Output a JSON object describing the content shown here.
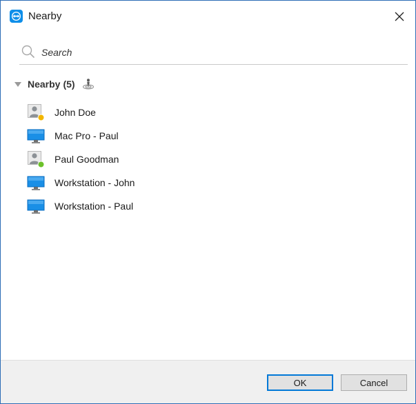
{
  "window": {
    "title": "Nearby",
    "close_symbol": "✕"
  },
  "search": {
    "placeholder": "Search",
    "value": ""
  },
  "group": {
    "title": "Nearby",
    "count": "(5)"
  },
  "items": [
    {
      "label": "John Doe",
      "type": "contact",
      "status": "away",
      "status_color": "#f2b600"
    },
    {
      "label": "Mac Pro - Paul",
      "type": "computer"
    },
    {
      "label": "Paul Goodman",
      "type": "contact",
      "status": "online",
      "status_color": "#6cc12a"
    },
    {
      "label": "Workstation - John",
      "type": "computer"
    },
    {
      "label": "Workstation - Paul",
      "type": "computer"
    }
  ],
  "buttons": {
    "ok": "OK",
    "cancel": "Cancel"
  },
  "colors": {
    "accent": "#0078d7",
    "app_icon": "#0e8ee9",
    "monitor": "#1a8fe6"
  },
  "icons": {
    "app": "teamviewer-icon",
    "close": "close-icon",
    "search": "search-icon",
    "group": "nearby-icon",
    "contact": "contact-icon",
    "computer": "computer-icon"
  }
}
